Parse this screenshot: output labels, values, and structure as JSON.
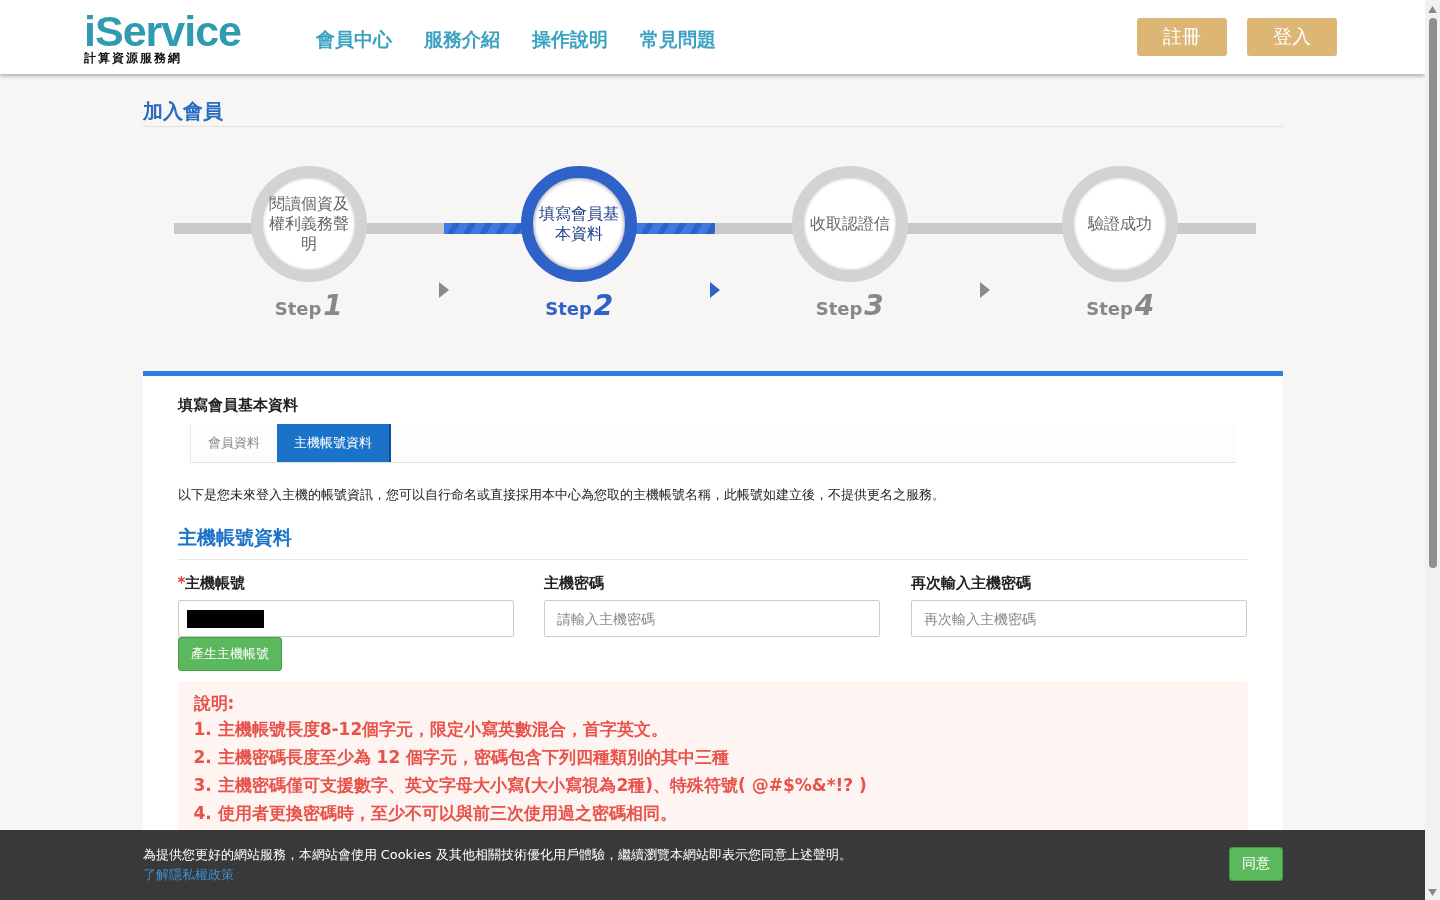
{
  "header": {
    "logo": {
      "name": "iService",
      "subtitle": "計算資源服務網"
    },
    "nav": [
      "會員中心",
      "服務介紹",
      "操作說明",
      "常見問題"
    ],
    "buttons": [
      "註冊",
      "登入"
    ]
  },
  "page_title": "加入會員",
  "steps": [
    {
      "label": "閱讀個資及權利義務聲明",
      "step": "Step",
      "number": "1",
      "selected": false
    },
    {
      "label": "填寫會員基本資料",
      "step": "Step",
      "number": "2",
      "selected": true
    },
    {
      "label": "收取認證信",
      "step": "Step",
      "number": "3",
      "selected": false
    },
    {
      "label": "驗證成功",
      "step": "Step",
      "number": "4",
      "selected": false
    }
  ],
  "form": {
    "title": "填寫會員基本資料",
    "tabs": [
      {
        "label": "會員資料",
        "selected": false
      },
      {
        "label": "主機帳號資料",
        "selected": true
      }
    ],
    "intro": "以下是您未來登入主機的帳號資訊，您可以自行命名或直接採用本中心為您取的主機帳號名稱，此帳號如建立後，不提供更名之服務。",
    "section_title": "主機帳號資料",
    "fields": [
      {
        "required_mark": "*",
        "label": "主機帳號",
        "value_redacted": true,
        "button": "產生主機帳號"
      },
      {
        "label": "主機密碼",
        "placeholder": "請輸入主機密碼"
      },
      {
        "label": "再次輸入主機密碼",
        "placeholder": "再次輸入主機密碼"
      }
    ],
    "notes": {
      "title": "說明:",
      "items": [
        "1. 主機帳號長度8-12個字元，限定小寫英數混合，首字英文。",
        "2. 主機密碼長度至少為 12 個字元，密碼包含下列四種類別的其中三種",
        "3. 主機密碼僅可支援數字、英文字母大小寫(大小寫視為2種)、特殊符號( @#$%&*!? )",
        "4. 使用者更換密碼時，至少不可以與前三次使用過之密碼相同。"
      ]
    }
  },
  "cookie_bar": {
    "text": "為提供您更好的網站服務，本網站會使用 Cookies 及其他相關技術優化用戶體驗，繼續瀏覽本網站即表示您同意上述聲明。",
    "link": "了解隱私權政策",
    "button": "同意"
  }
}
